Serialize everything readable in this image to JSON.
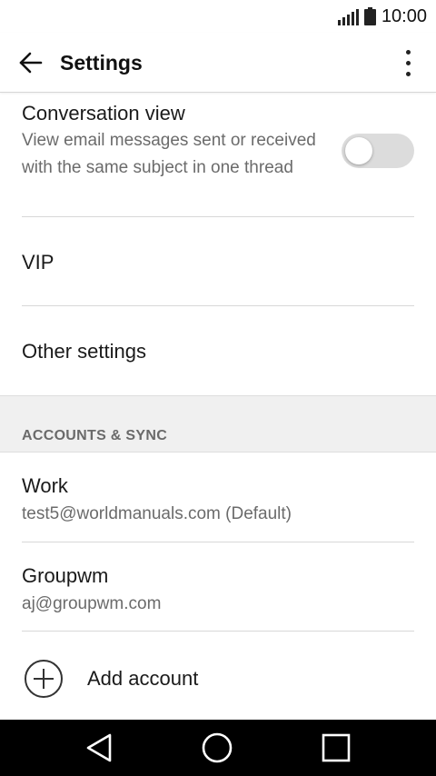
{
  "status_bar": {
    "time": "10:00",
    "icons": [
      "signal-icon",
      "battery-icon"
    ]
  },
  "app_bar": {
    "title": "Settings",
    "icons": [
      "back-arrow-icon",
      "more-vert-icon"
    ]
  },
  "settings": {
    "conversation_view": {
      "title": "Conversation view",
      "summary": "View email messages sent or received with the same subject in one thread",
      "enabled": false
    },
    "vip": {
      "title": "VIP"
    },
    "other_settings": {
      "title": "Other settings"
    }
  },
  "accounts_section": {
    "header": "ACCOUNTS & SYNC",
    "accounts": [
      {
        "name": "Work",
        "email": "test5@worldmanuals.com (Default)"
      },
      {
        "name": "Groupwm",
        "email": "aj@groupwm.com"
      }
    ],
    "add_account_label": "Add account"
  },
  "nav_bar": {
    "icons": [
      "nav-back-icon",
      "nav-home-icon",
      "nav-recents-icon"
    ]
  },
  "colors": {
    "section_header_bg": "#f0f0f0",
    "toggle_off_track": "#dcdcdc",
    "nav_bar_bg": "#000000"
  }
}
